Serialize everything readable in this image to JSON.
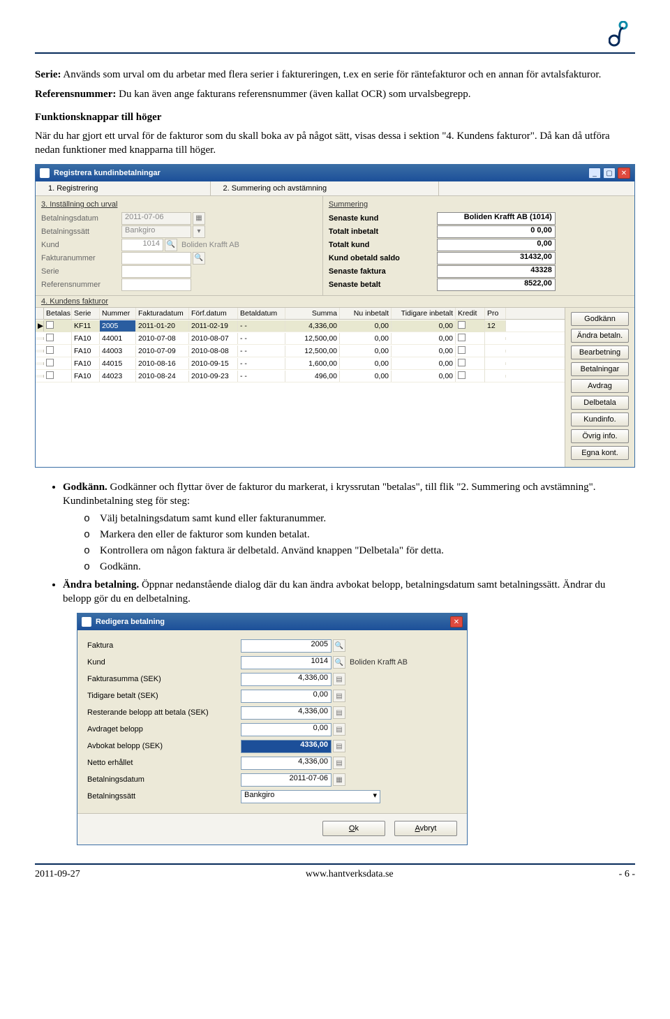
{
  "header_logo": "logo",
  "paragraphs": {
    "p1_lead": "Serie:",
    "p1_rest": " Används som urval om du arbetar med flera serier i faktureringen, t.ex en serie för räntefakturor och en annan för avtalsfakturor.",
    "p2_lead": "Referensnummer:",
    "p2_rest": " Du kan även ange fakturans referensnummer (även kallat OCR) som urvalsbegrepp.",
    "h1": "Funktionsknappar till höger",
    "p3": "När du har gjort ett urval för de fakturor som du skall boka av på något sätt, visas dessa i sektion \"4. Kundens fakturor\". Då kan då utföra nedan funktioner med knapparna till höger."
  },
  "win1": {
    "title": "Registrera kundinbetalningar",
    "tabs": [
      "1. Registrering",
      "2. Summering och avstämning"
    ],
    "section3": "3. Inställning och urval",
    "fields": {
      "betal_datum": {
        "label": "Betalningsdatum",
        "value": "2011-07-06"
      },
      "betal_satt": {
        "label": "Betalningssätt",
        "value": "Bankgiro"
      },
      "kund": {
        "label": "Kund",
        "value": "1014",
        "name": "Boliden Krafft AB"
      },
      "faktnr": {
        "label": "Fakturanummer",
        "value": ""
      },
      "serie": {
        "label": "Serie",
        "value": ""
      },
      "refnr": {
        "label": "Referensnummer",
        "value": ""
      }
    },
    "sum_title": "Summering",
    "sum": [
      {
        "l": "Senaste kund",
        "v": "Boliden Krafft AB (1014)"
      },
      {
        "l": "Totalt inbetalt",
        "v": "0           0,00"
      },
      {
        "l": "Totalt kund",
        "v": "0,00"
      },
      {
        "l": "Kund obetald saldo",
        "v": "31432,00"
      },
      {
        "l": "Senaste faktura",
        "v": "43328"
      },
      {
        "l": "Senaste betalt",
        "v": "8522,00"
      }
    ],
    "section4": "4. Kundens fakturor",
    "cols": [
      "",
      "Betalas",
      "Serie",
      "Nummer",
      "Fakturadatum",
      "Förf.datum",
      "Betaldatum",
      "Summa",
      "Nu inbetalt",
      "Tidigare inbetalt",
      "Kredit",
      "Pro"
    ],
    "rows": [
      {
        "sel": true,
        "betalas": "",
        "serie": "KF11",
        "nummer": "2005",
        "fdat": "2011-01-20",
        "forf": "2011-02-19",
        "bet": "- -",
        "summa": "4,336,00",
        "nu": "0,00",
        "tid": "0,00",
        "kredit": "",
        "pro": "12"
      },
      {
        "sel": false,
        "betalas": "",
        "serie": "FA10",
        "nummer": "44001",
        "fdat": "2010-07-08",
        "forf": "2010-08-07",
        "bet": "- -",
        "summa": "12,500,00",
        "nu": "0,00",
        "tid": "0,00",
        "kredit": "",
        "pro": ""
      },
      {
        "sel": false,
        "betalas": "",
        "serie": "FA10",
        "nummer": "44003",
        "fdat": "2010-07-09",
        "forf": "2010-08-08",
        "bet": "- -",
        "summa": "12,500,00",
        "nu": "0,00",
        "tid": "0,00",
        "kredit": "",
        "pro": ""
      },
      {
        "sel": false,
        "betalas": "",
        "serie": "FA10",
        "nummer": "44015",
        "fdat": "2010-08-16",
        "forf": "2010-09-15",
        "bet": "- -",
        "summa": "1,600,00",
        "nu": "0,00",
        "tid": "0,00",
        "kredit": "",
        "pro": ""
      },
      {
        "sel": false,
        "betalas": "",
        "serie": "FA10",
        "nummer": "44023",
        "fdat": "2010-08-24",
        "forf": "2010-09-23",
        "bet": "- -",
        "summa": "496,00",
        "nu": "0,00",
        "tid": "0,00",
        "kredit": "",
        "pro": ""
      }
    ],
    "buttons": [
      "Godkänn",
      "Ändra betaln.",
      "Bearbetning",
      "Betalningar",
      "Avdrag",
      "Delbetala",
      "Kundinfo.",
      "Övrig info.",
      "Egna kont."
    ]
  },
  "bullets": {
    "b1_lead": "Godkänn.",
    "b1_rest": " Godkänner och flyttar över de fakturor du markerat, i kryssrutan \"betalas\", till flik \"2. Summering och avstämning\".",
    "b1_sublabel": "Kundinbetalning steg för steg:",
    "subs": [
      "Välj betalningsdatum samt kund eller fakturanummer.",
      "Markera den eller de fakturor som kunden betalat.",
      "Kontrollera om någon faktura är delbetald. Använd knappen \"Delbetala\" för detta.",
      "Godkänn."
    ],
    "b2_lead": "Ändra betalning.",
    "b2_rest": " Öppnar nedanstående dialog där du kan ändra avbokat belopp, betalningsdatum samt betalningssätt. Ändrar du belopp gör du en delbetalning."
  },
  "win2": {
    "title": "Redigera betalning",
    "rows": [
      {
        "l": "Faktura",
        "v": "2005",
        "ico": "lookup"
      },
      {
        "l": "Kund",
        "v": "1014",
        "after": "Boliden Krafft AB",
        "ico": "lookup"
      },
      {
        "l": "Fakturasumma (SEK)",
        "v": "4,336,00",
        "ico": "calc"
      },
      {
        "l": "Tidigare betalt (SEK)",
        "v": "0,00",
        "ico": "calc"
      },
      {
        "l": "Resterande belopp att betala (SEK)",
        "v": "4,336,00",
        "ico": "calc"
      },
      {
        "l": "Avdraget belopp",
        "v": "0,00",
        "ico": "calc"
      },
      {
        "l": "Avbokat belopp (SEK)",
        "v": "4336,00",
        "ico": "calc",
        "hl": true
      },
      {
        "l": "Netto erhållet",
        "v": "4,336,00",
        "ico": "calc"
      },
      {
        "l": "Betalningsdatum",
        "v": "2011-07-06",
        "ico": "cal"
      },
      {
        "l": "Betalningssätt",
        "v": "Bankgiro",
        "select": true
      }
    ],
    "ok": "Ok",
    "cancel": "Avbryt"
  },
  "footer": {
    "left": "2011-09-27",
    "mid": "www.hantverksdata.se",
    "right": "- 6 -"
  }
}
